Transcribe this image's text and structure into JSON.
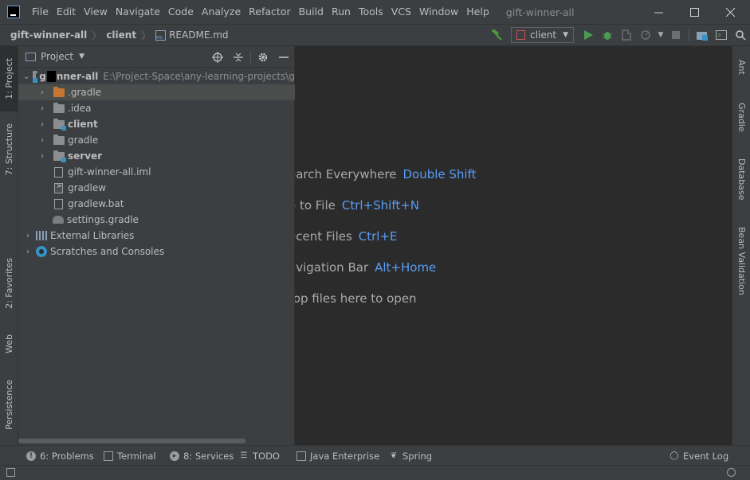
{
  "window": {
    "title": "gift-winner-all"
  },
  "menu": [
    "File",
    "Edit",
    "View",
    "Navigate",
    "Code",
    "Analyze",
    "Refactor",
    "Build",
    "Run",
    "Tools",
    "VCS",
    "Window",
    "Help"
  ],
  "breadcrumb": {
    "project": "gift-winner-all",
    "module": "client",
    "file": "README.md"
  },
  "toolbar": {
    "run_config": "client",
    "colors": {
      "build": "#4e9a3e",
      "run": "#499c54",
      "debug": "#499c54",
      "config_icon": "#c75450"
    }
  },
  "left_stripe": {
    "top": [
      "1: Project",
      "7: Structure"
    ],
    "bottom": [
      "2: Favorites",
      "Web",
      "Persistence"
    ]
  },
  "right_stripe": [
    "Ant",
    "Gradle",
    "Database",
    "Bean Validation"
  ],
  "project_panel": {
    "title": "Project",
    "root": {
      "name_prefix": "g",
      "name_suffix": "nner-all",
      "path": "E:\\Project-Space\\any-learning-projects\\g"
    },
    "items": [
      {
        "label": ".gradle",
        "kind": "folder-orange",
        "expandable": true,
        "bold": false,
        "selected": true
      },
      {
        "label": ".idea",
        "kind": "folder",
        "expandable": true,
        "bold": false
      },
      {
        "label": "client",
        "kind": "module",
        "expandable": true,
        "bold": true
      },
      {
        "label": "gradle",
        "kind": "folder",
        "expandable": true,
        "bold": false
      },
      {
        "label": "server",
        "kind": "module",
        "expandable": true,
        "bold": true
      },
      {
        "label": "gift-winner-all.iml",
        "kind": "iml",
        "expandable": false
      },
      {
        "label": "gradlew",
        "kind": "script",
        "expandable": false
      },
      {
        "label": "gradlew.bat",
        "kind": "bat",
        "expandable": false
      },
      {
        "label": "settings.gradle",
        "kind": "gradle",
        "expandable": false
      }
    ],
    "external_libraries": "External Libraries",
    "scratches": "Scratches and Consoles"
  },
  "editor_hints": [
    {
      "text": "earch Everywhere",
      "shortcut": "Double Shift"
    },
    {
      "text": "o to File",
      "shortcut": "Ctrl+Shift+N"
    },
    {
      "text": "ecent Files",
      "shortcut": "Ctrl+E"
    },
    {
      "text": "avigation Bar",
      "shortcut": "Alt+Home"
    },
    {
      "text": "rop files here to open",
      "shortcut": ""
    }
  ],
  "bottom_tools": {
    "problems": "6: Problems",
    "terminal": "Terminal",
    "services": "8: Services",
    "todo": "TODO",
    "java_enterprise": "Java Enterprise",
    "spring": "Spring",
    "event_log": "Event Log"
  }
}
